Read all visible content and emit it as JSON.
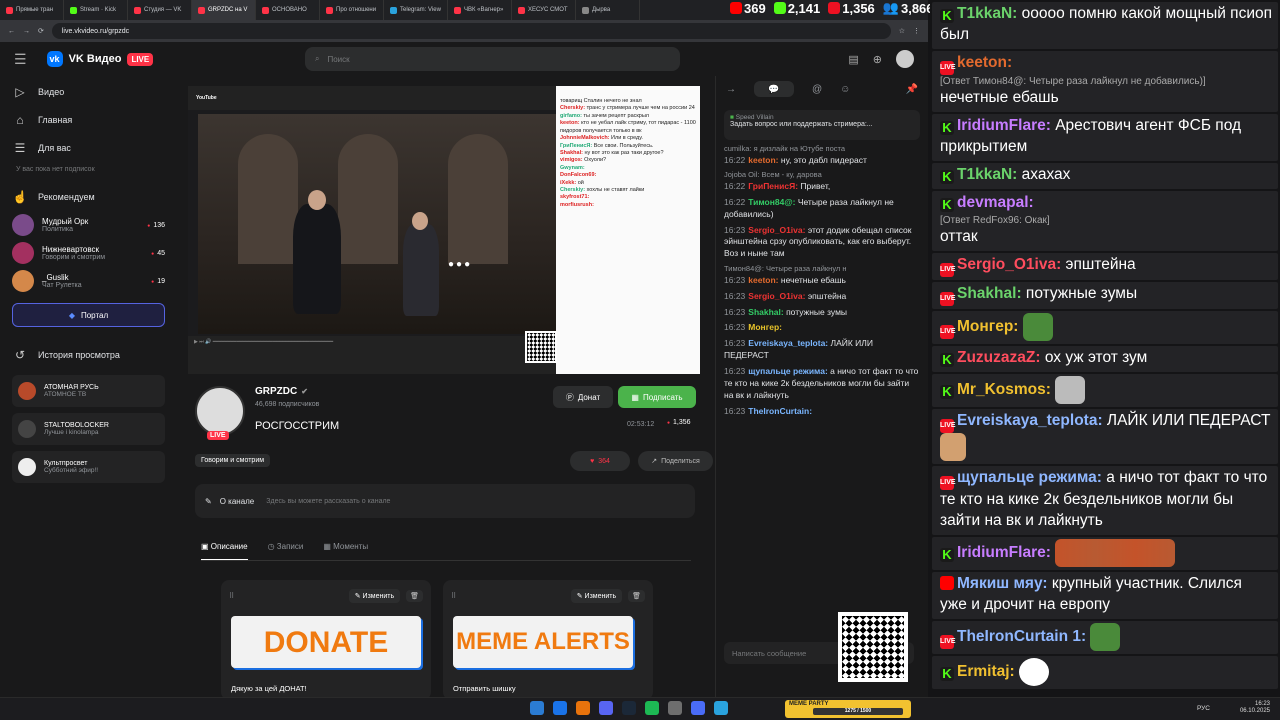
{
  "browser": {
    "tabs": [
      {
        "label": "Прямые тран",
        "color": "#ff3347"
      },
      {
        "label": "Stream · Kick",
        "color": "#53fc18"
      },
      {
        "label": "Студия — VK",
        "color": "#ff3347"
      },
      {
        "label": "GRPZDC на V",
        "color": "#ff3347",
        "active": true
      },
      {
        "label": "ОСНОВАНО",
        "color": "#ff3347"
      },
      {
        "label": "Про отношени",
        "color": "#ff3347"
      },
      {
        "label": "Telegram: View",
        "color": "#2aa3de"
      },
      {
        "label": "ЧВК «Вагнер»",
        "color": "#ff3347"
      },
      {
        "label": "ХЕСУС СМОТ",
        "color": "#ff3347"
      },
      {
        "label": "Дырва",
        "color": "#888888"
      }
    ],
    "url": "live.vkvideo.ru/grpzdc"
  },
  "stats": {
    "likes": "369",
    "kick": "2,141",
    "vk": "1,356",
    "viewers": "3,866"
  },
  "header": {
    "brand": "VK Видео",
    "live": "LIVE",
    "search_placeholder": "Поиск"
  },
  "sidebar": {
    "nav": [
      {
        "label": "Видео",
        "icon": "▷"
      },
      {
        "label": "Главная",
        "icon": "⌂"
      },
      {
        "label": "Для вас",
        "icon": "☰"
      }
    ],
    "no_subs": "У вас пока нет подписок",
    "recommended": "Рекомендуем",
    "channels": [
      {
        "name": "Мудрый Орк",
        "sub": "Политика",
        "count": "136",
        "color": "#7a4b8a"
      },
      {
        "name": "Нижневартовск",
        "sub": "Говорим и смотрим",
        "count": "45",
        "color": "#a33060"
      },
      {
        "name": "_Guslik",
        "sub": "Чат Рулетка",
        "count": "19",
        "color": "#d4884a"
      }
    ],
    "portal": "Портал",
    "history": "История просмотра",
    "history_items": [
      {
        "t1": "АТОМНАЯ РУСЬ",
        "t2": "АТОМНОЕ ТВ",
        "color": "#b84a2a"
      },
      {
        "t1": "STALTOBOLOCKER",
        "t2": "Лучше і kinolampa",
        "color": "#444444"
      },
      {
        "t1": "Культпросвет",
        "t2": "Субботний эфир!!",
        "color": "#eeeeee"
      }
    ]
  },
  "player": {
    "youtube": "YouTube",
    "chat_lines": [
      {
        "u": "",
        "t": "товарищ Сталин нечего не знал"
      },
      {
        "u": "Cherskiy:",
        "t": "транс у стримера лучше чем на россии 24"
      },
      {
        "u": "girfamo:",
        "t": "ты зачем рецепт раскрыл"
      },
      {
        "u": "keeton:",
        "t": "кто не уебал лайк стриму, тот пидарас - 1100 пидоров получается только в вк"
      },
      {
        "u": "JohnnieMalkovich:",
        "t": "Или в среду."
      },
      {
        "u": "ГриПенисЯ:",
        "t": "Все свои. Пользуйтесь."
      },
      {
        "u": "Shakhal:",
        "t": "ну вот это как раз таки другое?"
      },
      {
        "u": "vimigos:",
        "t": "Охуоли?"
      },
      {
        "u": "Gwynam:",
        "t": ""
      },
      {
        "u": "DonFalcon69:",
        "t": ""
      },
      {
        "u": "iXekk:",
        "t": "ой"
      },
      {
        "u": "Cherskiy:",
        "t": "хохлы не ставят лайки"
      },
      {
        "u": "skyfrost71:",
        "t": ""
      },
      {
        "u": "morfiusrush:",
        "t": ""
      }
    ]
  },
  "channel": {
    "name": "GRPZDC",
    "subs": "46,698 подписчиков",
    "title": "РОСГОССТРИМ",
    "donate": "Донат",
    "subscribe": "Подписать",
    "time": "02:53:12",
    "viewers": "1,356",
    "tag": "Говорим и смотрим",
    "likes": "364",
    "share": "Поделиться",
    "about": "О канале",
    "about_ph": "Здесь вы можете рассказать о канале",
    "tabs": [
      "Описание",
      "Записи",
      "Моменты"
    ],
    "edit": "Изменить",
    "panels": [
      {
        "banner": "DONATE",
        "caption": "Дякую за цей ДОНАТ!"
      },
      {
        "banner": "MEME ALERTS",
        "caption": "Отправить шишку"
      }
    ]
  },
  "vkchat": {
    "pin_name": "Speed Villain",
    "pin_text": "Задать вопрос или поддержать стримера:...",
    "messages": [
      {
        "rp": "cumilka: я дизлайк на Ютубе поста",
        "ts": "16:22",
        "nm": "keeton:",
        "c": "#e36a2e",
        "t": "ну, это дабл пидераст"
      },
      {
        "rp": "Jojoba Oil: Всем - ку, дарова",
        "ts": "16:22",
        "nm": "ГриПенисЯ:",
        "c": "#e33",
        "t": "Привет,"
      },
      {
        "rp": "",
        "ts": "16:22",
        "nm": "Тимон84@:",
        "c": "#3c6",
        "t": "Четыре раза лайкнул не добавились)"
      },
      {
        "rp": "",
        "ts": "16:23",
        "nm": "Sergio_O1iva:",
        "c": "#e33",
        "t": "этот додик обещал список эйнштейна срзу опубликовать, как его выберут. Воз и ныне там"
      },
      {
        "rp": "Тимон84@: Четыре раза лайкнул н",
        "ts": "16:23",
        "nm": "keeton:",
        "c": "#e36a2e",
        "t": "нечетные ебашь"
      },
      {
        "rp": "",
        "ts": "16:23",
        "nm": "Sergio_O1iva:",
        "c": "#e33",
        "t": "эпштейна"
      },
      {
        "rp": "",
        "ts": "16:23",
        "nm": "Shakhal:",
        "c": "#3c6",
        "t": "потужные зумы"
      },
      {
        "rp": "",
        "ts": "16:23",
        "nm": "Монгер:",
        "c": "#e8c32a",
        "t": ""
      },
      {
        "rp": "",
        "ts": "16:23",
        "nm": "Evreiskaya_teplota:",
        "c": "#7ab6ff",
        "t": "ЛАЙК ИЛИ ПЕДЕРАСТ"
      },
      {
        "rp": "",
        "ts": "16:23",
        "nm": "щупальце режима:",
        "c": "#7ab6ff",
        "t": "а ничо тот факт то что те кто на кике 2к бездельников могли бы зайти на вк и лайкнуть"
      },
      {
        "rp": "",
        "ts": "16:23",
        "nm": "TheIronCurtain:",
        "c": "#7ab6ff",
        "t": ""
      }
    ],
    "input_ph": "Написать сообщение"
  },
  "bigchat": [
    {
      "src": "kk",
      "nm": "T1kkaN:",
      "c": "#6bd36b",
      "t": "ооооо помню какой мощный псиоп был"
    },
    {
      "src": "vk",
      "nm": "keeton:",
      "c": "#e36a2e",
      "rp": "[Ответ Тимон84@: Четыре раза лайкнул не добавились)]",
      "t": "нечетные ебашь"
    },
    {
      "src": "kk",
      "nm": "IridiumFlare:",
      "c": "#c77dff",
      "t": "Арестович агент ФСБ под прикрытием"
    },
    {
      "src": "kk",
      "nm": "T1kkaN:",
      "c": "#6bd36b",
      "t": "ахахах"
    },
    {
      "src": "kk",
      "nm": "devmapal:",
      "c": "#c77dff",
      "rp": "[Ответ RedFox96: Окак]",
      "t": "оттак"
    },
    {
      "src": "vk",
      "nm": "Sergio_O1iva:",
      "c": "#ff4d5e",
      "t": "эпштейна"
    },
    {
      "src": "vk",
      "nm": "Shakhal:",
      "c": "#6bd36b",
      "t": "потужные зумы"
    },
    {
      "src": "vk",
      "nm": "Монгер:",
      "c": "#f0c030",
      "t": "",
      "emote": "pepe"
    },
    {
      "src": "kk",
      "nm": "ZuzuzazaZ:",
      "c": "#ff4d5e",
      "t": "ох уж этот зум"
    },
    {
      "src": "kk",
      "nm": "Mr_Kosmos:",
      "c": "#f0c030",
      "t": "",
      "emote": "cat"
    },
    {
      "src": "vk",
      "nm": "Evreiskaya_teplota:",
      "c": "#8fb7ff",
      "t": "ЛАЙК ИЛИ ПЕДЕРАСТ",
      "emote": "dance"
    },
    {
      "src": "vk",
      "nm": "щупальце режима:",
      "c": "#8fb7ff",
      "t": "а ничо тот факт то что те кто на кике 2к бездельников могли бы зайти на вк и лайкнуть"
    },
    {
      "src": "kk",
      "nm": "IridiumFlare:",
      "c": "#c77dff",
      "t": "",
      "emote": "long"
    },
    {
      "src": "yt",
      "nm": "Мякиш мяу:",
      "c": "#8fb7ff",
      "t": "крупный участник. Слился уже и дрочит на европу"
    },
    {
      "src": "vk",
      "nm": "TheIronCurtain 1:",
      "c": "#8fb7ff",
      "t": "",
      "emote": "pepe"
    },
    {
      "src": "kk",
      "nm": "Ermitaj:",
      "c": "#f0c030",
      "t": "",
      "emote": "jk"
    }
  ],
  "taskbar": {
    "meme": "MEME PARTY",
    "meme_bar": "1275 / 1500",
    "lang": "РУС",
    "time": "16:23",
    "date": "06.10.2025"
  }
}
